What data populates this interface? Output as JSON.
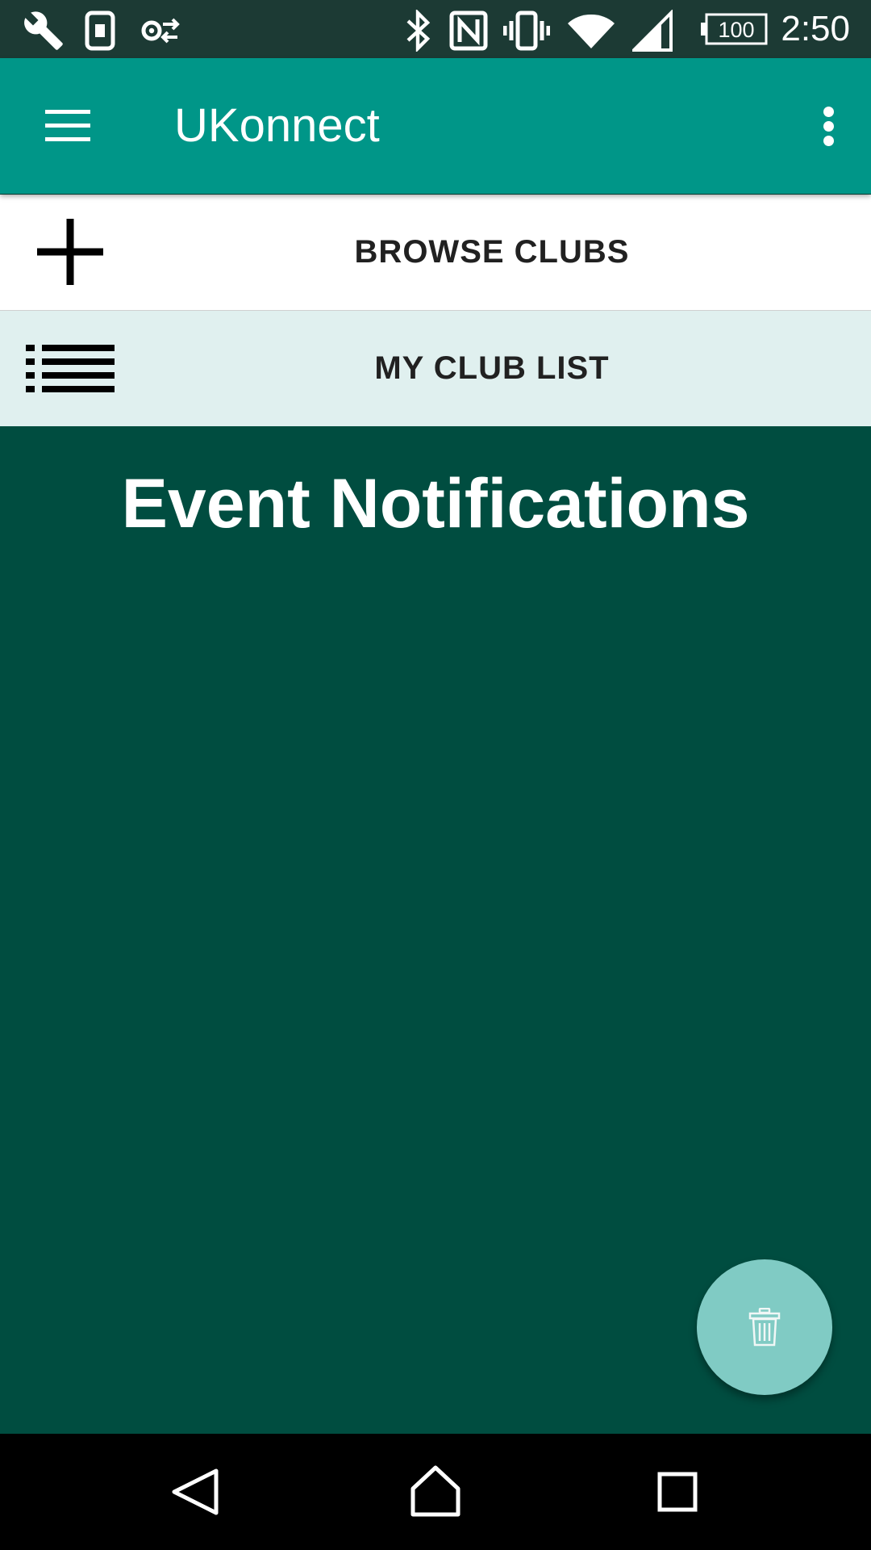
{
  "status_bar": {
    "time": "2:50",
    "battery_level": "100",
    "left_icons": [
      "wrench-icon",
      "sim-toolkit-icon",
      "settings-sync-icon"
    ],
    "right_icons": [
      "bluetooth-icon",
      "nfc-icon",
      "vibrate-icon",
      "wifi-icon",
      "cell-signal-icon",
      "battery-icon"
    ]
  },
  "app_bar": {
    "title": "UKonnect",
    "menu_icon": "hamburger-menu-icon",
    "overflow_icon": "more-vert-icon",
    "background": "#009688"
  },
  "nav_items": [
    {
      "label": "BROWSE CLUBS",
      "icon": "plus-icon"
    },
    {
      "label": "MY CLUB LIST",
      "icon": "list-icon"
    }
  ],
  "content": {
    "heading": "Event Notifications",
    "background": "#004d40"
  },
  "fab": {
    "icon": "trash-icon",
    "color": "#80cbc4"
  },
  "system_nav": {
    "buttons": [
      "back-icon",
      "home-icon",
      "recents-icon"
    ]
  }
}
